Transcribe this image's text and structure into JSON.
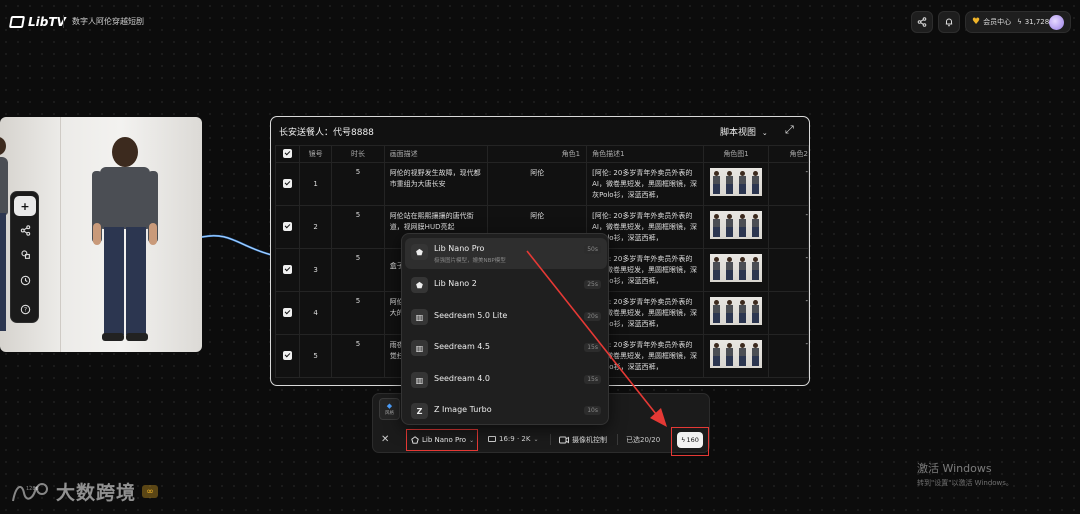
{
  "header": {
    "logo_text": "LibTV",
    "project_title": "数字人阿伦穿越短剧",
    "member_label": "会员中心",
    "credits": "31,728"
  },
  "left_toolbar": {
    "items": [
      {
        "icon": "plus-icon"
      },
      {
        "icon": "share-nodes-icon"
      },
      {
        "icon": "asset-icon"
      },
      {
        "icon": "history-clock-icon"
      },
      {
        "icon": "help-icon"
      }
    ]
  },
  "panel": {
    "title": "长安送餐人：代号8888",
    "view_label": "脚本视图",
    "columns": [
      "",
      "镜号",
      "时长",
      "画面描述",
      "角色1",
      "角色描述1",
      "角色图1",
      "角色2"
    ],
    "rows": [
      {
        "no": "1",
        "dur": "5",
        "desc": "阿伦的视野发生故障，现代都市重组为大唐长安",
        "role": "阿伦",
        "cdesc": "[阿伦: 20多岁青年外卖员外表的AI，微卷黑短发，黑圆框眼镜，深灰Polo衫，深蓝西裤，",
        "role2": "-"
      },
      {
        "no": "2",
        "dur": "5",
        "desc": "阿伦站在熙熙攘攘的唐代街道，视网膜HUD亮起",
        "role": "阿伦",
        "cdesc": "[阿伦: 20多岁青年外卖员外表的AI，微卷黑短发，黑圆框眼镜，深灰Polo衫，深蓝西裤，",
        "role2": "-"
      },
      {
        "no": "3",
        "dur": "5",
        "desc": "盒子",
        "role": "",
        "cdesc": "[阿伦: 20多岁青年外卖员外表的AI，微卷黑短发，黑圆框眼镜，深灰Polo衫，深蓝西裤，",
        "role2": "-"
      },
      {
        "no": "4",
        "dur": "5",
        "desc": "阿伦\n大的",
        "role": "",
        "cdesc": "[阿伦: 20多岁青年外卖员外表的AI，微卷黑短发，黑圆框眼镜，深灰Polo衫，深蓝西裤，",
        "role2": "-"
      },
      {
        "no": "5",
        "dur": "5",
        "desc": "雨夜\n觉扫",
        "role": "",
        "cdesc": "[阿伦: 20多岁青年外卖员外表的AI，微卷黑短发，黑圆框眼镜，深灰Polo衫，深蓝西裤，",
        "role2": "-"
      }
    ]
  },
  "dropdown": {
    "items": [
      {
        "name": "Lib Nano Pro",
        "sub": "极强图片模型，媲美NBP模型",
        "badge": "50s",
        "icon": "banana-icon"
      },
      {
        "name": "Lib Nano 2",
        "sub": "",
        "badge": "25s",
        "icon": "banana-icon"
      },
      {
        "name": "Seedream 5.0 Lite",
        "sub": "",
        "badge": "20s",
        "icon": "seedream-icon"
      },
      {
        "name": "Seedream 4.5",
        "sub": "",
        "badge": "15s",
        "icon": "seedream-icon"
      },
      {
        "name": "Seedream 4.0",
        "sub": "",
        "badge": "15s",
        "icon": "seedream-icon"
      },
      {
        "name": "Z Image Turbo",
        "sub": "",
        "badge": "10s",
        "icon": "z-icon"
      }
    ]
  },
  "bottom_bar": {
    "chip_label": "风格",
    "model": "Lib Nano Pro",
    "ratio": "16:9 · 2K",
    "camera": "摄像机控制",
    "selected": "已选20/20",
    "cost": "160"
  },
  "watermark": {
    "text": "大数跨境",
    "badge": "1288"
  },
  "windows_activation": {
    "title": "激活 Windows",
    "subtitle": "转到\"设置\"以激活 Windows。"
  },
  "colors": {
    "highlight": "#e53935",
    "brand_gold": "#f0b429",
    "background": "#0c0c0c"
  }
}
